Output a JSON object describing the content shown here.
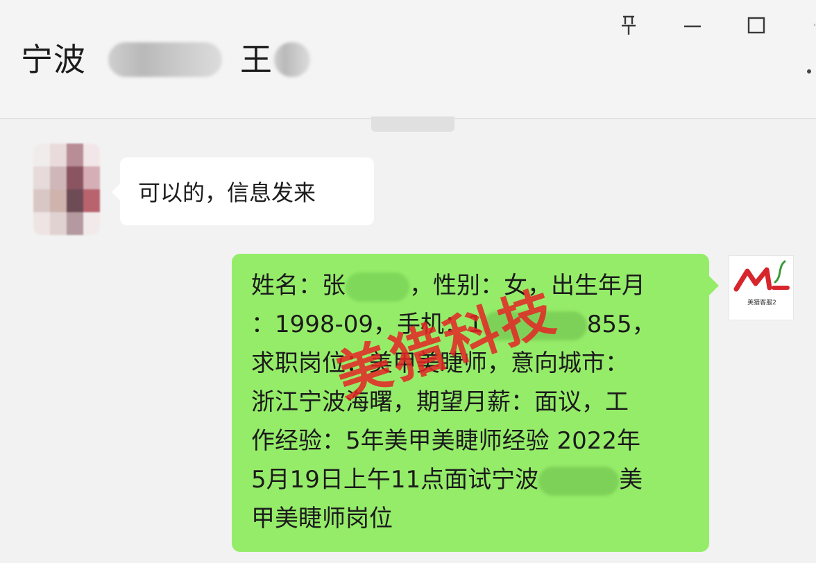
{
  "window": {
    "title_prefix": "宁波",
    "title_mid": "王",
    "pin_icon_glyph": "📌",
    "minimize_glyph": "—",
    "maximize_glyph": "☐",
    "close_glyph": "✕"
  },
  "messages": {
    "incoming_text": "可以的，信息发来",
    "outgoing_lines": [
      "姓名：张",
      "，性别：女，出生年月",
      "：1998-09，手机：1",
      "855，",
      "求职岗位：美甲美睫师，意向城市：",
      "浙江宁波海曙，期望月薪：面议，工",
      "作经验：5年美甲美睫师经验 2022年",
      "5月19日上午11点面试宁波",
      "美",
      "甲美睫师岗位"
    ]
  },
  "watermark": {
    "text": "美猎科技",
    "color": "#e42424"
  },
  "avatar_right": {
    "logo_text": "ML",
    "caption": "美猎客服2"
  },
  "colors": {
    "background": "#f2f2f2",
    "outgoing_bubble": "#95ec69",
    "incoming_bubble": "#ffffff"
  }
}
